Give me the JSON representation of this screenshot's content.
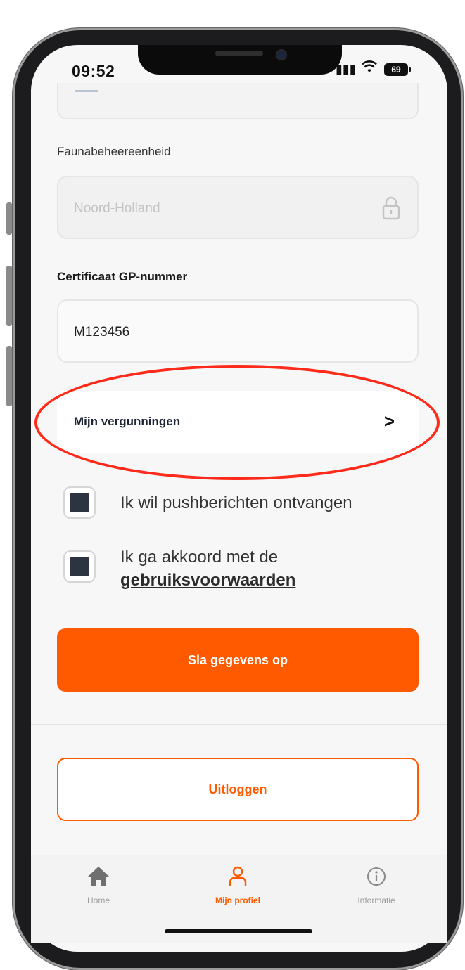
{
  "status_bar": {
    "time": "09:52",
    "battery": "69"
  },
  "form": {
    "fauna_label": "Faunabeheereenheid",
    "fauna_value": "Noord-Holland",
    "cert_label": "Certificaat GP-nummer",
    "cert_value": "M123456"
  },
  "licenses_row": {
    "label": "Mijn vergunningen",
    "chevron": ">"
  },
  "checkboxes": {
    "push_label": "Ik wil pushberichten ontvangen",
    "terms_prefix": "Ik ga akkoord met de",
    "terms_link": "gebruiksvoorwaarden"
  },
  "buttons": {
    "save": "Sla gegevens op",
    "logout": "Uitloggen"
  },
  "tabbar": {
    "items": [
      {
        "label": "Home",
        "icon": "home-icon"
      },
      {
        "label": "Mijn profiel",
        "icon": "user-icon"
      },
      {
        "label": "Informatie",
        "icon": "info-icon"
      }
    ]
  },
  "colors": {
    "accent": "#ff5a00",
    "highlight_circle": "#ff2a1a"
  }
}
